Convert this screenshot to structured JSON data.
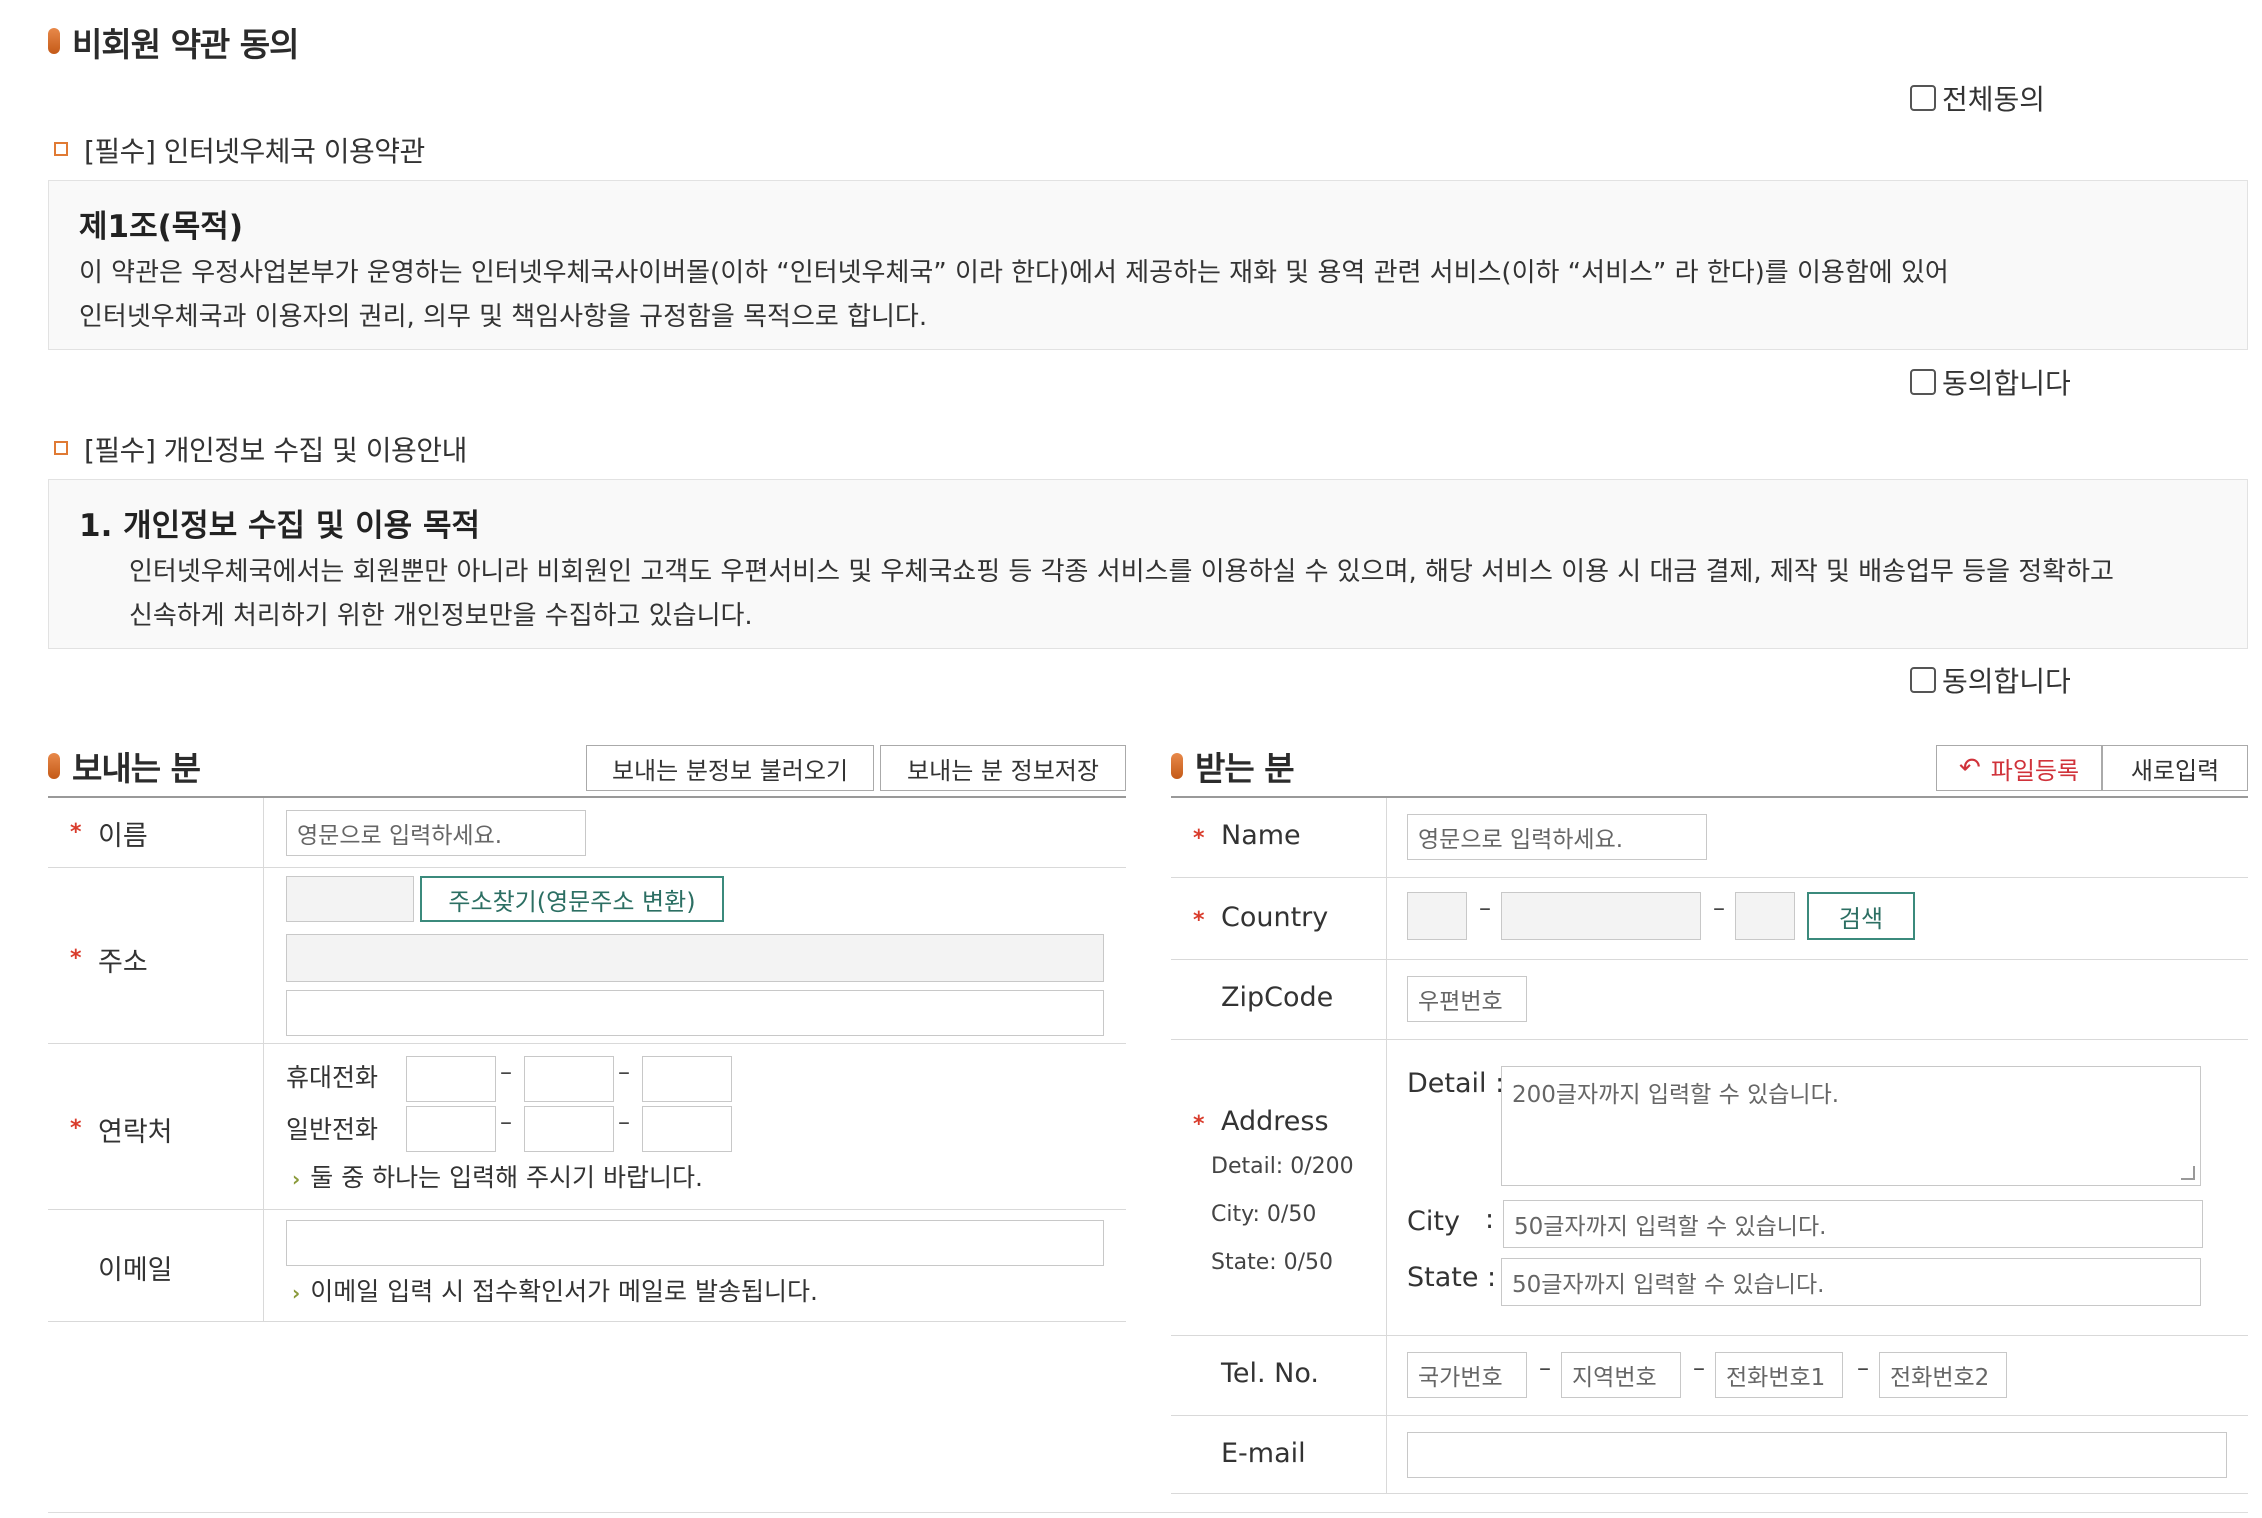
{
  "page_title": "비회원 약관 동의",
  "agree_all": "전체동의",
  "terms1": {
    "title": "[필수] 인터넷우체국 이용약관",
    "heading": "제1조(목적)",
    "line1": "이 약관은 우정사업본부가 운영하는 인터넷우체국사이버몰(이하 “인터넷우체국” 이라 한다)에서 제공하는 재화 및 용역 관련 서비스(이하 “서비스” 라 한다)를 이용함에 있어",
    "line2": "인터넷우체국과 이용자의 권리, 의무 및 책임사항을 규정함을 목적으로 합니다.",
    "agree": "동의합니다"
  },
  "terms2": {
    "title": "[필수] 개인정보 수집 및 이용안내",
    "heading": "1. 개인정보 수집 및 이용 목적",
    "line1": "인터넷우체국에서는 회원뿐만 아니라 비회원인 고객도 우편서비스 및 우체국쇼핑 등 각종 서비스를 이용하실 수 있으며, 해당 서비스 이용 시 대금 결제, 제작 및 배송업무 등을 정확하고",
    "line2": "신속하게 처리하기 위한 개인정보만을 수집하고 있습니다.",
    "agree": "동의합니다"
  },
  "sender": {
    "title": "보내는 분",
    "btn_load": "보내는 분정보 불러오기",
    "btn_save": "보내는 분 정보저장",
    "name_label": "이름",
    "name_placeholder": "영문으로 입력하세요.",
    "addr_label": "주소",
    "addr_search": "주소찾기(영문주소 변환)",
    "contact_label": "연락처",
    "mobile_label": "휴대전화",
    "phone_label": "일반전화",
    "contact_note": "둘 중 하나는 입력해 주시기 바랍니다.",
    "email_label": "이메일",
    "email_note": "이메일 입력 시 접수확인서가 메일로 발송됩니다."
  },
  "receiver": {
    "title": "받는 분",
    "btn_file": "파일등록",
    "btn_new": "새로입력",
    "name_label": "Name",
    "name_placeholder": "영문으로 입력하세요.",
    "country_label": "Country",
    "country_search": "검색",
    "zip_label": "ZipCode",
    "zip_placeholder": "우편번호",
    "address_label": "Address",
    "detail_count": "Detail: 0/200",
    "city_count": "City: 0/50",
    "state_count": "State: 0/50",
    "detail_label": "Detail :",
    "detail_placeholder": "200글자까지 입력할 수 있습니다.",
    "city_label": "City",
    "city_colon": ":",
    "city_placeholder": "50글자까지 입력할 수 있습니다.",
    "state_label": "State :",
    "state_placeholder": "50글자까지 입력할 수 있습니다.",
    "tel_label": "Tel. No.",
    "tel_country": "국가번호",
    "tel_area": "지역번호",
    "tel_num1": "전화번호1",
    "tel_num2": "전화번호2",
    "email_label": "E-mail"
  },
  "required_mark": "*",
  "dash": "–",
  "colors": {
    "accent": "#d06a28",
    "required": "#d93c2c",
    "green": "#3b8a7c"
  }
}
